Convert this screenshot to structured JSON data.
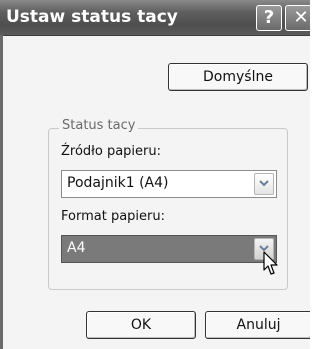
{
  "window": {
    "title": "Ustaw status tacy"
  },
  "titlebar": {
    "help_glyph": "?",
    "close_glyph": "✕"
  },
  "buttons": {
    "default_label": "Domyślne",
    "ok_label": "OK",
    "cancel_label": "Anuluj"
  },
  "tray_status": {
    "group_label": "Status tacy",
    "paper_source": {
      "label": "Źródło papieru:",
      "value": "Podajnik1 (A4)"
    },
    "paper_format": {
      "label": "Format papieru:",
      "value": "A4"
    }
  },
  "icons": [
    "help-icon",
    "close-icon",
    "chevron-down-icon",
    "mouse-pointer-icon"
  ],
  "colors": {
    "titlebar": "#5e5e5e",
    "dialog_bg": "#f4f4f4",
    "selected_combo": "#7a7a7a"
  }
}
